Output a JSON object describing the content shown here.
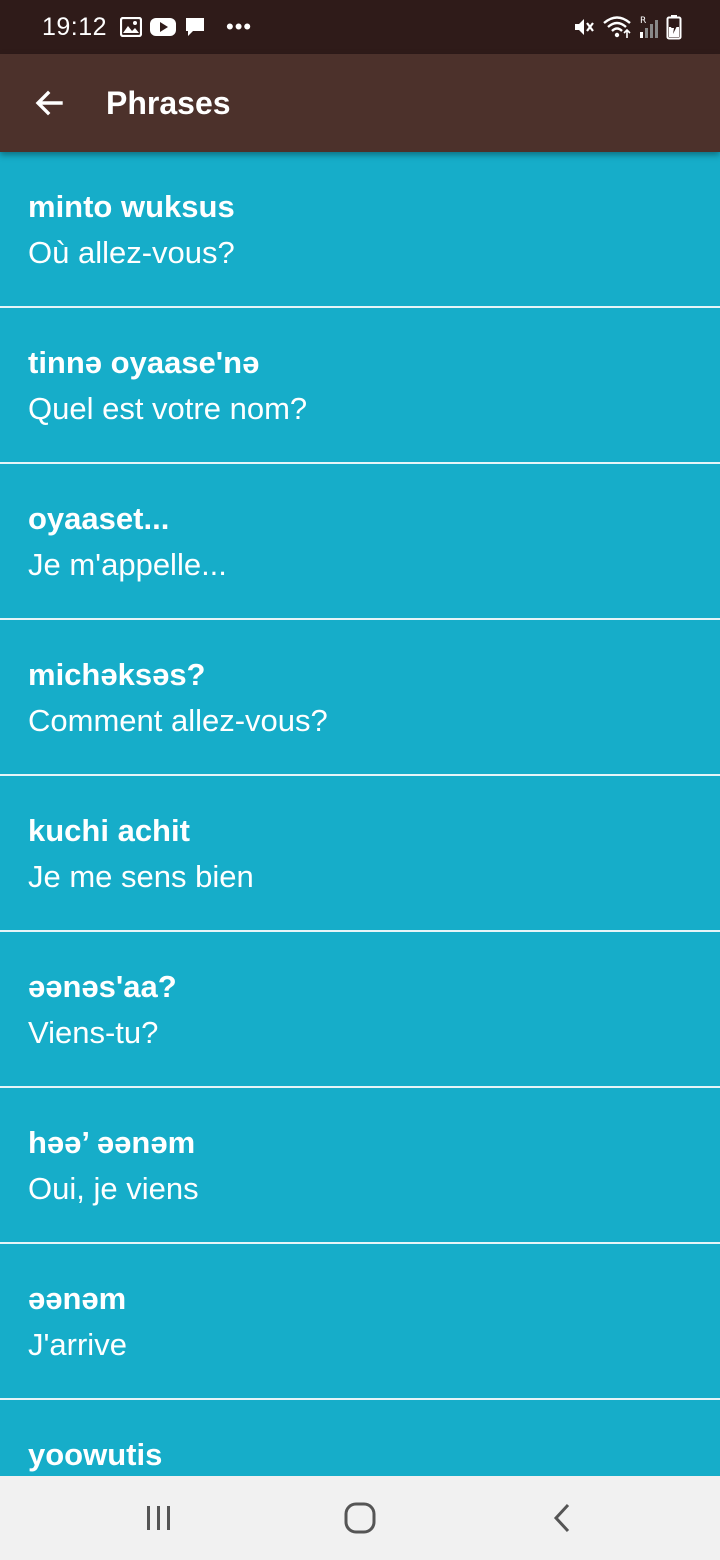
{
  "status_bar": {
    "time": "19:12",
    "more": "•••",
    "left_icons": [
      "gallery-icon",
      "youtube-icon",
      "message-icon"
    ],
    "right_icons": [
      "mute-icon",
      "wifi-icon",
      "signal-icon",
      "battery-icon"
    ]
  },
  "app_bar": {
    "title": "Phrases",
    "back_icon": "arrow-back-icon",
    "background": "#4c312b"
  },
  "colors": {
    "status_bar": "#2f1b19",
    "list_background": "#16adc9",
    "divider": "#e6f5f8",
    "text": "#ffffff",
    "nav_bar": "#f1f1f1"
  },
  "phrases": [
    {
      "native": "minto wuksus",
      "translation": "Où allez-vous?"
    },
    {
      "native": "tinnə oyaase'nə",
      "translation": "Quel est votre nom?"
    },
    {
      "native": "oyaaset...",
      "translation": "Je m'appelle..."
    },
    {
      "native": "michəksəs?",
      "translation": "Comment allez-vous?"
    },
    {
      "native": "kuchi achit",
      "translation": "Je me sens bien"
    },
    {
      "native": "əənəs'aa?",
      "translation": "Viens-tu?"
    },
    {
      "native": "həə’ əənəm",
      "translation": "Oui, je viens"
    },
    {
      "native": "əənəm",
      "translation": "J'arrive"
    },
    {
      "native": "yoowutis",
      "translation": ""
    }
  ],
  "nav_bar": {
    "icons": [
      "recents-icon",
      "home-icon",
      "back-icon"
    ]
  }
}
